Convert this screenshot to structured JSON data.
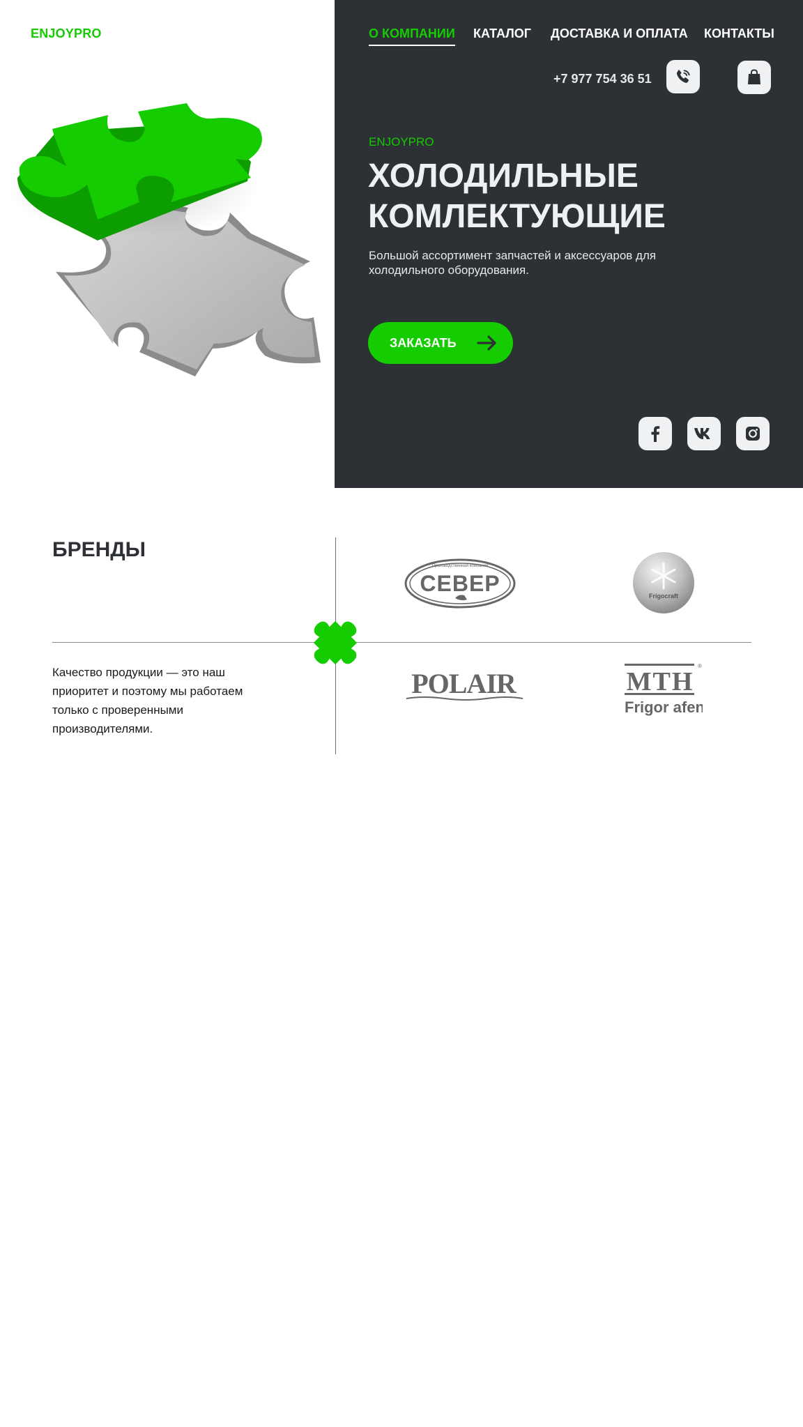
{
  "header": {
    "logo": "ENJOYPRO",
    "nav": [
      {
        "label": "О КОМПАНИИ",
        "active": true
      },
      {
        "label": "КАТАЛОГ"
      },
      {
        "label": "ДОСТАВКА И ОПЛАТА"
      },
      {
        "label": "КОНТАКТЫ"
      }
    ],
    "phone": "+7 977 754 36 51"
  },
  "hero": {
    "kicker": "ENJOYPRO",
    "title": "Холодильные комлектующие",
    "subtitle": "Большой ассортимент запчастей и аксессуаров для холодильного оборудования.",
    "cta_label": "ЗАКАЗАТЬ"
  },
  "social": [
    "facebook-icon",
    "vk-icon",
    "instagram-icon"
  ],
  "brands": {
    "title": "БРЕНДЫ",
    "text": "Качество продукции — это наш приоритет и поэтому мы работаем только с проверенными производителями.",
    "logos": [
      {
        "name": "СЕВЕР",
        "tagline": "Производственная компания"
      },
      {
        "name": "Frigocraft"
      },
      {
        "name": "POLAIR"
      },
      {
        "name": "MTH",
        "sub": "Frigor afen"
      }
    ]
  },
  "colors": {
    "accent": "#14cc00",
    "dark": "#2d3035",
    "light": "#eff1f3"
  }
}
